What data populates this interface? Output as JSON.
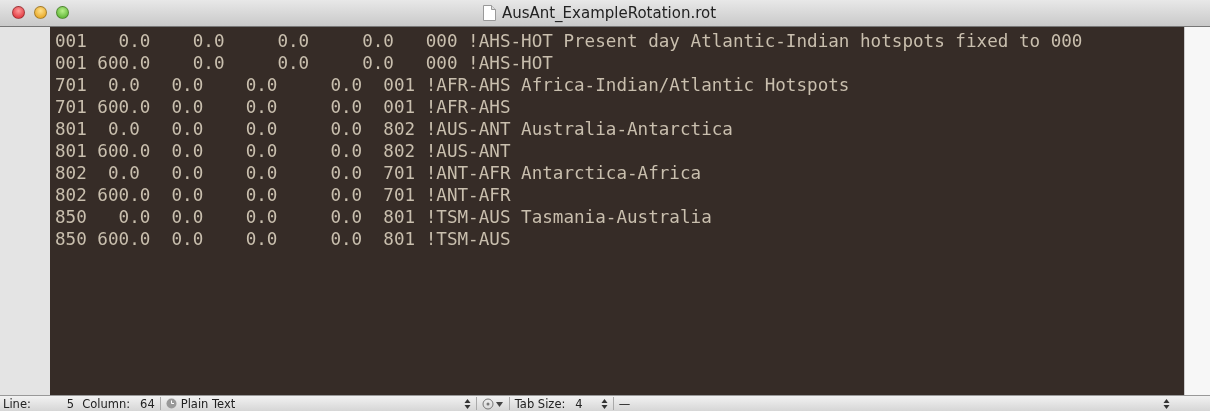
{
  "window": {
    "title": "AusAnt_ExampleRotation.rot"
  },
  "editor": {
    "lines": [
      "001   0.0    0.0     0.0     0.0   000 !AHS-HOT Present day Atlantic-Indian hotspots fixed to 000",
      "001 600.0    0.0     0.0     0.0   000 !AHS-HOT",
      "701  0.0   0.0    0.0     0.0  001 !AFR-AHS Africa-Indian/Atlantic Hotspots",
      "701 600.0  0.0    0.0     0.0  001 !AFR-AHS",
      "801  0.0   0.0    0.0     0.0  802 !AUS-ANT Australia-Antarctica",
      "801 600.0  0.0    0.0     0.0  802 !AUS-ANT",
      "802  0.0   0.0    0.0     0.0  701 !ANT-AFR Antarctica-Africa",
      "802 600.0  0.0    0.0     0.0  701 !ANT-AFR",
      "850   0.0  0.0    0.0     0.0  801 !TSM-AUS Tasmania-Australia",
      "850 600.0  0.0    0.0     0.0  801 !TSM-AUS"
    ]
  },
  "status_bar": {
    "line_label": "Line:",
    "line_value": "5",
    "column_label": "Column:",
    "column_value": "64",
    "syntax": "Plain Text",
    "tab_size_label": "Tab Size:",
    "tab_size_value": "4",
    "symbol": "—"
  }
}
